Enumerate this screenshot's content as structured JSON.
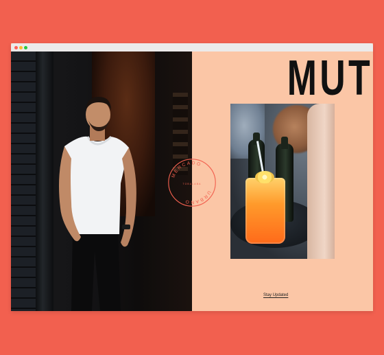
{
  "brand": {
    "name": "MUT"
  },
  "badge": {
    "line1": "MERCADO",
    "line2": "URBANO",
    "subtitle": "TOBALABA"
  },
  "cta": {
    "stay_updated": "Stay Updated"
  },
  "colors": {
    "page_background": "#f2604f",
    "content_background": "#fbc6a6",
    "badge_accent": "#f2604f"
  }
}
